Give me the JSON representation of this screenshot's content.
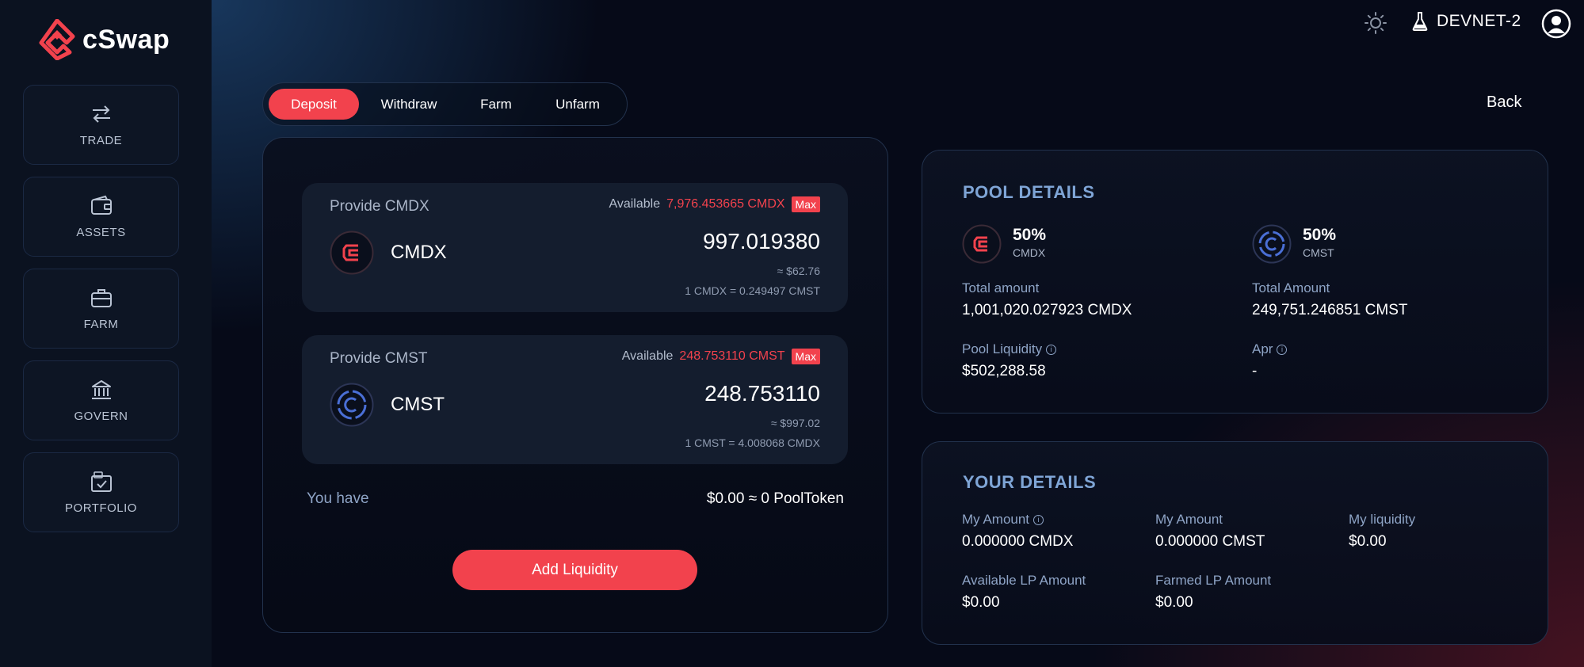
{
  "brand": {
    "name": "cSwap"
  },
  "sidebar": {
    "items": [
      {
        "label": "TRADE",
        "icon": "swap-arrows-icon"
      },
      {
        "label": "ASSETS",
        "icon": "wallet-icon"
      },
      {
        "label": "FARM",
        "icon": "briefcase-icon"
      },
      {
        "label": "GOVERN",
        "icon": "bank-icon"
      },
      {
        "label": "PORTFOLIO",
        "icon": "portfolio-icon"
      }
    ]
  },
  "topbar": {
    "network": "DEVNET-2"
  },
  "tabs": [
    {
      "label": "Deposit",
      "active": true
    },
    {
      "label": "Withdraw",
      "active": false
    },
    {
      "label": "Farm",
      "active": false
    },
    {
      "label": "Unfarm",
      "active": false
    }
  ],
  "back_label": "Back",
  "deposit": {
    "cmdx": {
      "provide_label": "Provide CMDX",
      "available_label": "Available",
      "available_value": "7,976.453665 CMDX",
      "max_label": "Max",
      "token": "CMDX",
      "amount": "997.019380",
      "usd": "≈ $62.76",
      "rate": "1 CMDX = 0.249497 CMST"
    },
    "cmst": {
      "provide_label": "Provide CMST",
      "available_label": "Available",
      "available_value": "248.753110 CMST",
      "max_label": "Max",
      "token": "CMST",
      "amount": "248.753110",
      "usd": "≈ $997.02",
      "rate": "1 CMST = 4.008068 CMDX"
    },
    "you_have_label": "You have",
    "pool_token": "$0.00 ≈ 0 PoolToken",
    "add_liquidity_label": "Add Liquidity"
  },
  "pool_details": {
    "title": "POOL DETAILS",
    "cmdx": {
      "pct": "50%",
      "symbol": "CMDX",
      "total_label": "Total amount",
      "total_value": "1,001,020.027923 CMDX"
    },
    "cmst": {
      "pct": "50%",
      "symbol": "CMST",
      "total_label": "Total Amount",
      "total_value": "249,751.246851 CMST"
    },
    "liquidity_label": "Pool Liquidity",
    "liquidity_value": "$502,288.58",
    "apr_label": "Apr",
    "apr_value": "-"
  },
  "your_details": {
    "title": "YOUR DETAILS",
    "my_amount_cmdx_label": "My Amount",
    "my_amount_cmdx_value": "0.000000 CMDX",
    "my_amount_cmst_label": "My Amount",
    "my_amount_cmst_value": "0.000000 CMST",
    "my_liquidity_label": "My liquidity",
    "my_liquidity_value": "$0.00",
    "available_lp_label": "Available LP Amount",
    "available_lp_value": "$0.00",
    "farmed_lp_label": "Farmed LP Amount",
    "farmed_lp_value": "$0.00"
  },
  "colors": {
    "accent": "#f2424d",
    "title_blue": "#7fa5d6",
    "label_blue": "#8ea4c6",
    "cmst_blue": "#4a6fd6"
  }
}
